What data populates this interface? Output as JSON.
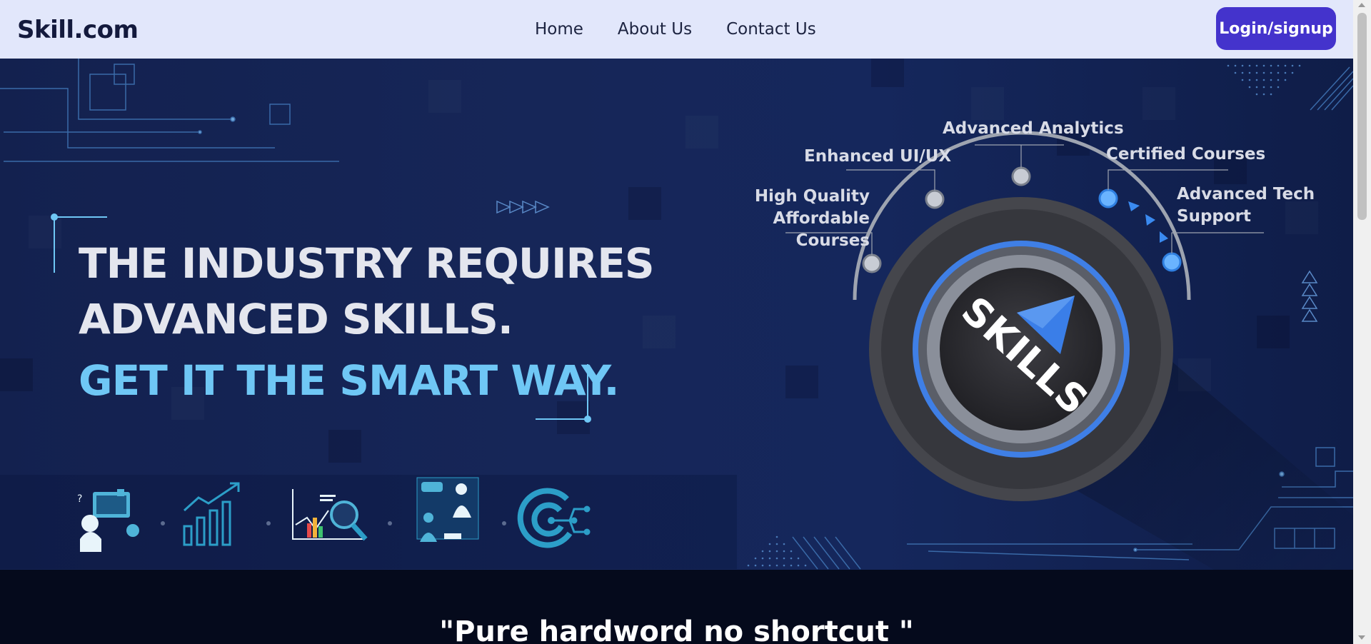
{
  "nav": {
    "brand": "Skill.com",
    "links": [
      "Home",
      "About Us",
      "Contact Us"
    ],
    "login_label": "Login/signup"
  },
  "hero": {
    "line1": "THE INDUSTRY REQUIRES",
    "line2": "ADVANCED SKILLS.",
    "accent": "GET IT THE SMART WAY.",
    "dial_text": "SKILLS",
    "dial_labels": {
      "quality_1": "High Quality",
      "quality_2": "Affordable Courses",
      "uiux": "Enhanced UI/UX",
      "analytics": "Advanced Analytics",
      "certified": "Certified Courses",
      "tech_1": "Advanced Tech",
      "tech_2": "Support"
    },
    "feature_icons": [
      "computer-user-icon",
      "growth-chart-icon",
      "analytics-magnifier-icon",
      "presentation-icon",
      "target-icon"
    ]
  },
  "quote": "\"Pure hardword no shortcut \"",
  "colors": {
    "nav_bg": "#e2e7fb",
    "login_bg": "#4433cc",
    "hero_bg": "#15275c",
    "accent": "#6fc7f5",
    "quote_bg": "#050a1c"
  }
}
